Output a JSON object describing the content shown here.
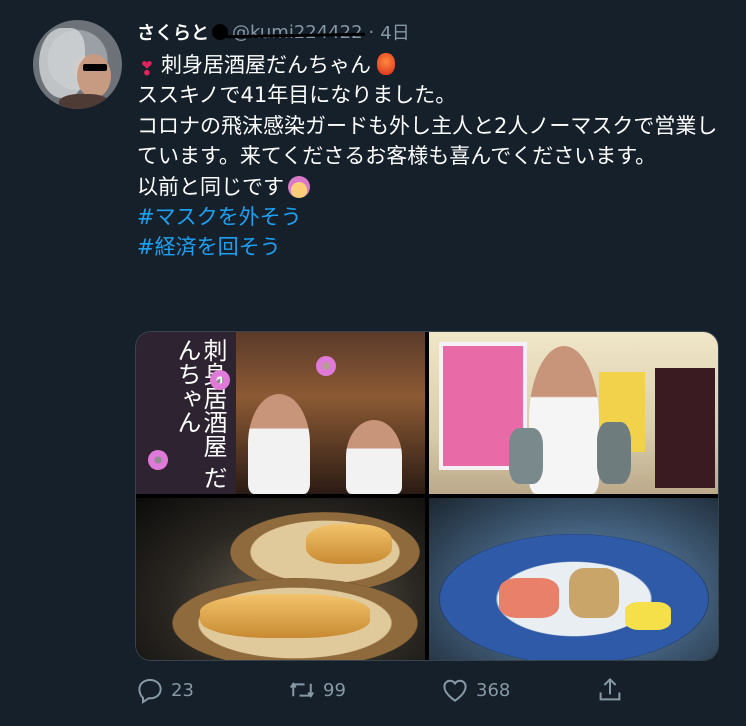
{
  "tweet": {
    "display_name": "さくらと",
    "handle": "@kumi224422",
    "separator": "·",
    "time": "4日",
    "lines": [
      "刺身居酒屋だんちゃん",
      "ススキノで41年目になりました。",
      "コロナの飛沫感染ガードも外し主人と2人ノーマスクで営業しています。来てくださるお客様も喜んでくださいます。",
      "以前と同じです"
    ],
    "hashtags": [
      "#マスクを外そう",
      "#経済を回そう"
    ]
  },
  "media": {
    "photo1_sign": "刺身居酒屋 だんちゃん"
  },
  "actions": {
    "reply_count": "23",
    "retweet_count": "99",
    "like_count": "368"
  },
  "icons": [
    "reply-icon",
    "retweet-icon",
    "like-icon",
    "share-icon"
  ],
  "colors": {
    "background": "#15202b",
    "text": "#ffffff",
    "secondary": "#8899a6",
    "link": "#1da1f2"
  }
}
